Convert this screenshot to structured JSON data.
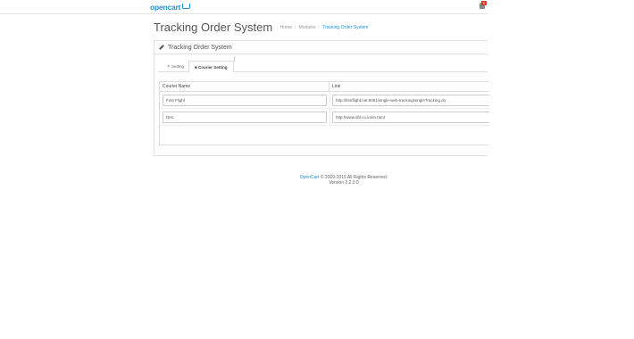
{
  "header": {
    "logo_text": "opencart",
    "notification_count": "6"
  },
  "heading": {
    "title": "Tracking Order System",
    "breadcrumb": [
      "Home",
      "Modules",
      "Tracking Order System"
    ]
  },
  "panel": {
    "title": "Tracking Order System",
    "tabs": [
      {
        "label": "Setting",
        "icon": "wrench-icon",
        "active": false
      },
      {
        "label": "Courier Setting",
        "icon": "truck-icon",
        "active": true
      }
    ]
  },
  "table": {
    "headers": [
      "Courier Name",
      "Link"
    ],
    "rows": [
      {
        "name": "First Flight",
        "link": "http://firstflight.net:8081/single-web-tracking/singleTracking.do"
      },
      {
        "name": "DHL",
        "link": "http://www.dhl.co.in/en.html"
      }
    ]
  },
  "footer": {
    "brand": "OpenCart",
    "copyright": " © 2009-2015 All Rights Reserved.",
    "version": "Version 2.2.0.0"
  },
  "colors": {
    "accent": "#1e91cf",
    "badge": "#e0301e"
  }
}
